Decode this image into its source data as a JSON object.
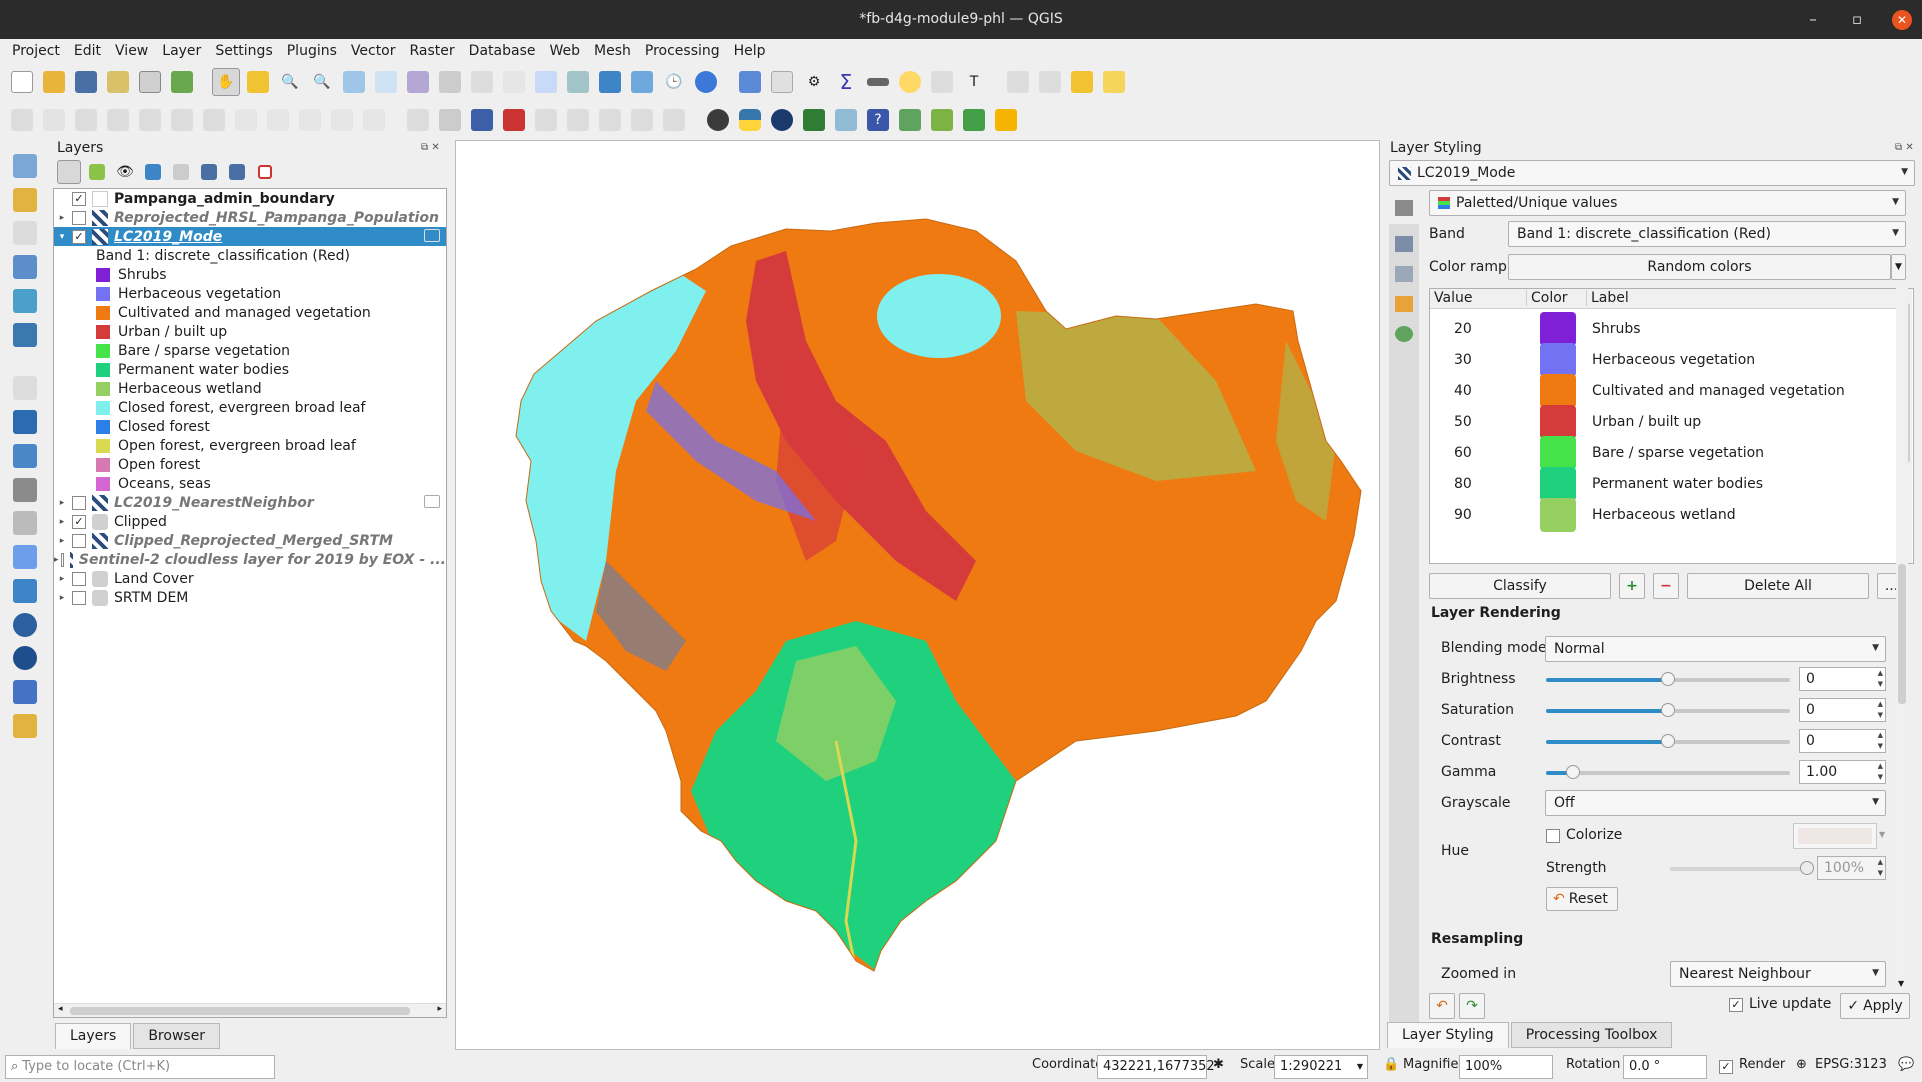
{
  "window": {
    "title": "*fb-d4g-module9-phl — QGIS"
  },
  "menu": [
    "Project",
    "Edit",
    "View",
    "Layer",
    "Settings",
    "Plugins",
    "Vector",
    "Raster",
    "Database",
    "Web",
    "Mesh",
    "Processing",
    "Help"
  ],
  "layers_panel": {
    "title": "Layers",
    "layers": [
      {
        "name": "Pampanga_admin_boundary",
        "checked": true,
        "style": "bold",
        "expand": false
      },
      {
        "name": "Reprojected_HRSL_Pampanga_Population",
        "checked": false,
        "style": "italic",
        "expand": true
      },
      {
        "name": "LC2019_Mode",
        "checked": true,
        "style": "selected",
        "expand": true
      }
    ],
    "band_label": "Band 1: discrete_classification (Red)",
    "legend": [
      {
        "label": "Shrubs",
        "color": "#7f1fd6"
      },
      {
        "label": "Herbaceous vegetation",
        "color": "#7272f2"
      },
      {
        "label": "Cultivated and managed vegetation",
        "color": "#ef7a12"
      },
      {
        "label": "Urban / built up",
        "color": "#d53b3b"
      },
      {
        "label": "Bare / sparse vegetation",
        "color": "#46e24a"
      },
      {
        "label": "Permanent water bodies",
        "color": "#1fd17c"
      },
      {
        "label": "Herbaceous wetland",
        "color": "#95cf62"
      },
      {
        "label": "Closed forest, evergreen broad leaf",
        "color": "#7ff0ee"
      },
      {
        "label": "Closed forest",
        "color": "#2b7fe6"
      },
      {
        "label": "Open forest, evergreen broad leaf",
        "color": "#d8d851"
      },
      {
        "label": "Open forest",
        "color": "#d778b3"
      },
      {
        "label": "Oceans, seas",
        "color": "#d466d4"
      }
    ],
    "more_layers": [
      {
        "name": "LC2019_NearestNeighbor",
        "checked": false,
        "style": "italic"
      },
      {
        "name": "Clipped",
        "checked": true,
        "style": "normal"
      },
      {
        "name": "Clipped_Reprojected_Merged_SRTM",
        "checked": false,
        "style": "italic"
      },
      {
        "name": "Sentinel-2 cloudless layer for 2019 by EOX - ...",
        "checked": false,
        "style": "italic"
      },
      {
        "name": "Land Cover",
        "checked": false,
        "style": "normal"
      },
      {
        "name": "SRTM DEM",
        "checked": false,
        "style": "normal"
      }
    ],
    "tabs": [
      "Layers",
      "Browser"
    ]
  },
  "styling": {
    "title": "Layer Styling",
    "layer": "LC2019_Mode",
    "renderer": "Paletted/Unique values",
    "band_label": "Band",
    "band_value": "Band 1: discrete_classification (Red)",
    "ramp_label": "Color ramp",
    "ramp_value": "Random colors",
    "columns": [
      "Value",
      "Color",
      "Label"
    ],
    "classes": [
      {
        "value": "20",
        "color": "#7f1fd6",
        "label": "Shrubs"
      },
      {
        "value": "30",
        "color": "#7272f2",
        "label": "Herbaceous vegetation"
      },
      {
        "value": "40",
        "color": "#ef7a12",
        "label": "Cultivated and managed vegetation"
      },
      {
        "value": "50",
        "color": "#d53b3b",
        "label": "Urban / built up"
      },
      {
        "value": "60",
        "color": "#46e24a",
        "label": "Bare / sparse vegetation"
      },
      {
        "value": "80",
        "color": "#1fd17c",
        "label": "Permanent water bodies"
      },
      {
        "value": "90",
        "color": "#95cf62",
        "label": "Herbaceous wetland"
      }
    ],
    "classify": "Classify",
    "delete_all": "Delete All",
    "more": "...",
    "rendering_title": "Layer Rendering",
    "blending_label": "Blending mode",
    "blending_value": "Normal",
    "brightness_label": "Brightness",
    "brightness": "0",
    "brightness_pos": 0.5,
    "saturation_label": "Saturation",
    "saturation": "0",
    "saturation_pos": 0.5,
    "contrast_label": "Contrast",
    "contrast": "0",
    "contrast_pos": 0.5,
    "gamma_label": "Gamma",
    "gamma": "1.00",
    "gamma_pos": 0.11,
    "grayscale_label": "Grayscale",
    "grayscale_value": "Off",
    "hue_label": "Hue",
    "colorize": "Colorize",
    "strength_label": "Strength",
    "strength": "100%",
    "reset": "Reset",
    "resampling_title": "Resampling",
    "zoomed_in_label": "Zoomed in",
    "zoomed_in_value": "Nearest Neighbour",
    "live_update": "Live update",
    "apply": "Apply",
    "tabs": [
      "Layer Styling",
      "Processing Toolbox"
    ]
  },
  "status": {
    "locate_placeholder": "Type to locate (Ctrl+K)",
    "coordinate_label": "Coordinate",
    "coordinate": "432221,1677352",
    "scale_label": "Scale",
    "scale": "1:290221",
    "magnifier_label": "Magnifier",
    "magnifier": "100%",
    "rotation_label": "Rotation",
    "rotation": "0.0 °",
    "render_label": "Render",
    "crs": "EPSG:3123"
  },
  "icons": [
    "new-project-icon",
    "open-icon",
    "save-icon",
    "pan-icon",
    "zoom-in-icon",
    "zoom-out-icon",
    "identify-icon",
    "python-icon",
    "gear-icon",
    "sigma-icon",
    "help-icon"
  ]
}
